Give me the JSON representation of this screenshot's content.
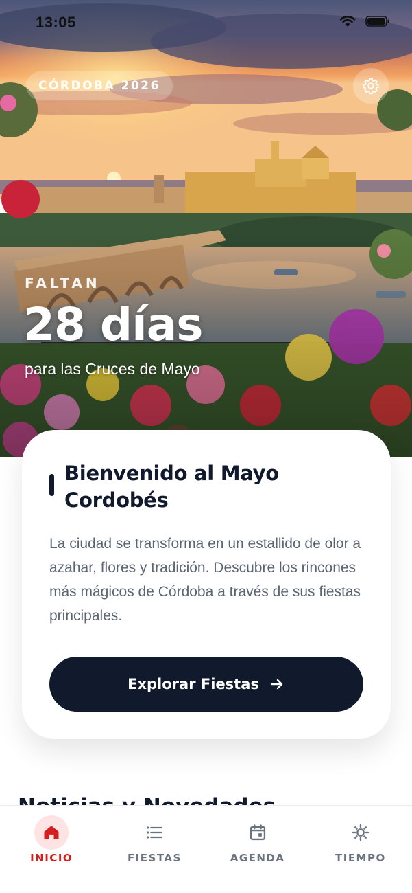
{
  "status_bar": {
    "time": "13:05",
    "icons": [
      "wifi-icon",
      "battery-icon"
    ]
  },
  "hero": {
    "brand": "CÓRDOBA 2026",
    "settings_icon": "gear-icon",
    "countdown_label": "FALTAN",
    "countdown_value": "28 días",
    "countdown_sub": "para las Cruces de Mayo"
  },
  "welcome": {
    "title": "Bienvenido al Mayo Cordobés",
    "body": "La ciudad se transforma en un estallido de olor a azahar, flores y tradición. Descubre los rincones más mágicos de Córdoba a través de sus fiestas principales.",
    "button_label": "Explorar Fiestas",
    "button_icon": "arrow-right-icon"
  },
  "news": {
    "heading": "Noticias y Novedades"
  },
  "tabs": [
    {
      "label": "INICIO",
      "icon": "home-icon",
      "active": true
    },
    {
      "label": "FIESTAS",
      "icon": "list-icon",
      "active": false
    },
    {
      "label": "AGENDA",
      "icon": "calendar-icon",
      "active": false
    },
    {
      "label": "TIEMPO",
      "icon": "sun-icon",
      "active": false
    }
  ],
  "colors": {
    "accent": "#d51f1f",
    "primary": "#111a2c",
    "active_tab_bg": "#fde3e3"
  }
}
